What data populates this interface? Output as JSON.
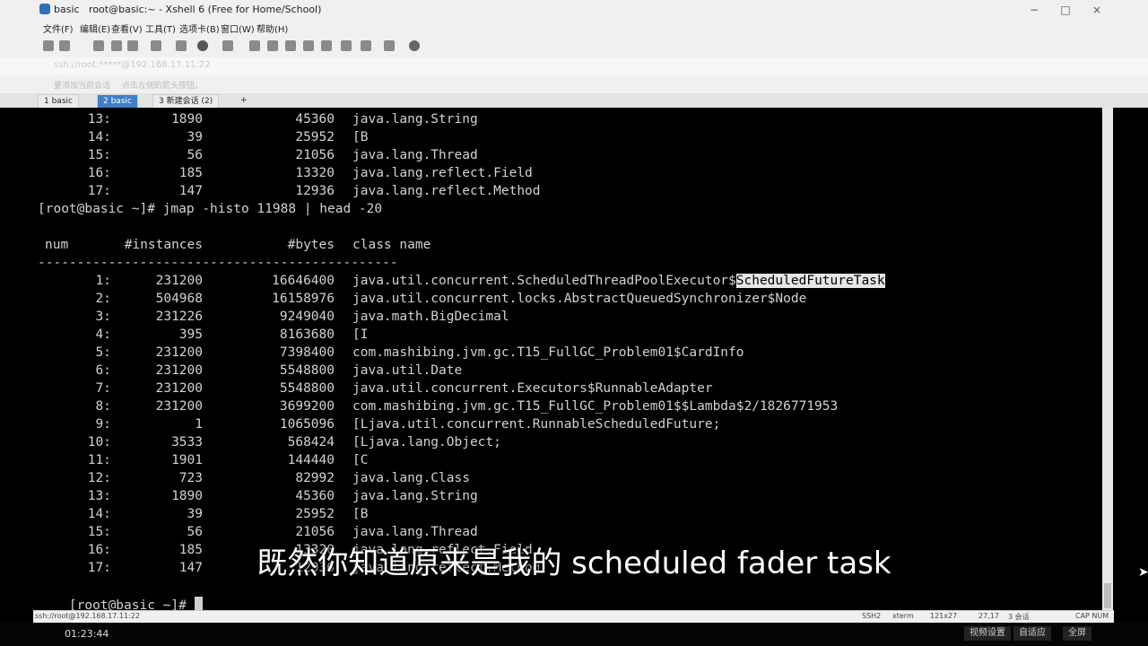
{
  "window": {
    "title": "basic   root@basic:~ - Xshell 6 (Free for Home/School)",
    "minimize": "−",
    "maximize": "□",
    "close": "×"
  },
  "menu": [
    "文件(F)",
    "编辑(E)",
    "查看(V)",
    "工具(T)",
    "选项卡(B)",
    "窗口(W)",
    "帮助(H)"
  ],
  "address": "ssh://root:*****@192.168.17.11:22",
  "notes": [
    "要添加当前会话",
    "点击左侧的箭头按钮。"
  ],
  "tabs": [
    {
      "label": "1 basic",
      "active": false
    },
    {
      "label": "2 basic",
      "active": true
    },
    {
      "label": "3 新建会话 (2)",
      "active": false
    },
    {
      "label": "+",
      "active": false
    }
  ],
  "terminal": {
    "top_rows": [
      {
        "num": "13:",
        "inst": "1890",
        "bytes": "45360",
        "cls": "java.lang.String"
      },
      {
        "num": "14:",
        "inst": "39",
        "bytes": "25952",
        "cls": "[B"
      },
      {
        "num": "15:",
        "inst": "56",
        "bytes": "21056",
        "cls": "java.lang.Thread"
      },
      {
        "num": "16:",
        "inst": "185",
        "bytes": "13320",
        "cls": "java.lang.reflect.Field"
      },
      {
        "num": "17:",
        "inst": "147",
        "bytes": "12936",
        "cls": "java.lang.reflect.Method"
      }
    ],
    "command": "[root@basic ~]# jmap -histo 11988 | head -20",
    "header": {
      "num": "num",
      "inst": "#instances",
      "bytes": "#bytes",
      "cls": "class name"
    },
    "separator": "----------------------------------------------",
    "rows": [
      {
        "num": "1:",
        "inst": "231200",
        "bytes": "16646400",
        "cls": "java.util.concurrent.ScheduledThreadPoolExecutor$",
        "cls_hl": "ScheduledFutureTask"
      },
      {
        "num": "2:",
        "inst": "504968",
        "bytes": "16158976",
        "cls": "java.util.concurrent.locks.AbstractQueuedSynchronizer$Node"
      },
      {
        "num": "3:",
        "inst": "231226",
        "bytes": "9249040",
        "cls": "java.math.BigDecimal"
      },
      {
        "num": "4:",
        "inst": "395",
        "bytes": "8163680",
        "cls": "[I"
      },
      {
        "num": "5:",
        "inst": "231200",
        "bytes": "7398400",
        "cls": "com.mashibing.jvm.gc.T15_FullGC_Problem01$CardInfo"
      },
      {
        "num": "6:",
        "inst": "231200",
        "bytes": "5548800",
        "cls": "java.util.Date"
      },
      {
        "num": "7:",
        "inst": "231200",
        "bytes": "5548800",
        "cls": "java.util.concurrent.Executors$RunnableAdapter"
      },
      {
        "num": "8:",
        "inst": "231200",
        "bytes": "3699200",
        "cls": "com.mashibing.jvm.gc.T15_FullGC_Problem01$$Lambda$2/1826771953"
      },
      {
        "num": "9:",
        "inst": "1",
        "bytes": "1065096",
        "cls": "[Ljava.util.concurrent.RunnableScheduledFuture;"
      },
      {
        "num": "10:",
        "inst": "3533",
        "bytes": "568424",
        "cls": "[Ljava.lang.Object;"
      },
      {
        "num": "11:",
        "inst": "1901",
        "bytes": "144440",
        "cls": "[C"
      },
      {
        "num": "12:",
        "inst": "723",
        "bytes": "82992",
        "cls": "java.lang.Class"
      },
      {
        "num": "13:",
        "inst": "1890",
        "bytes": "45360",
        "cls": "java.lang.String"
      },
      {
        "num": "14:",
        "inst": "39",
        "bytes": "25952",
        "cls": "[B"
      },
      {
        "num": "15:",
        "inst": "56",
        "bytes": "21056",
        "cls": "java.lang.Thread"
      },
      {
        "num": "16:",
        "inst": "185",
        "bytes": "13320",
        "cls": "java.lang.reflect.Field"
      },
      {
        "num": "17:",
        "inst": "147",
        "bytes": "12936",
        "cls": "java.lang.reflect.Method"
      }
    ],
    "prompt": "[root@basic ~]# "
  },
  "subtitle": "既然你知道原来是我的 scheduled fader task",
  "status": {
    "address": "ssh://root@192.168.17.11:22",
    "protocol": "SSH2",
    "term": "xterm",
    "size": "121x27",
    "pos": "27,17",
    "sessions": "3 会话",
    "caps": "CAP NUM"
  },
  "video": {
    "time": "01:23:44",
    "buttons": [
      "视频设置",
      "自适应",
      "全屏"
    ]
  }
}
